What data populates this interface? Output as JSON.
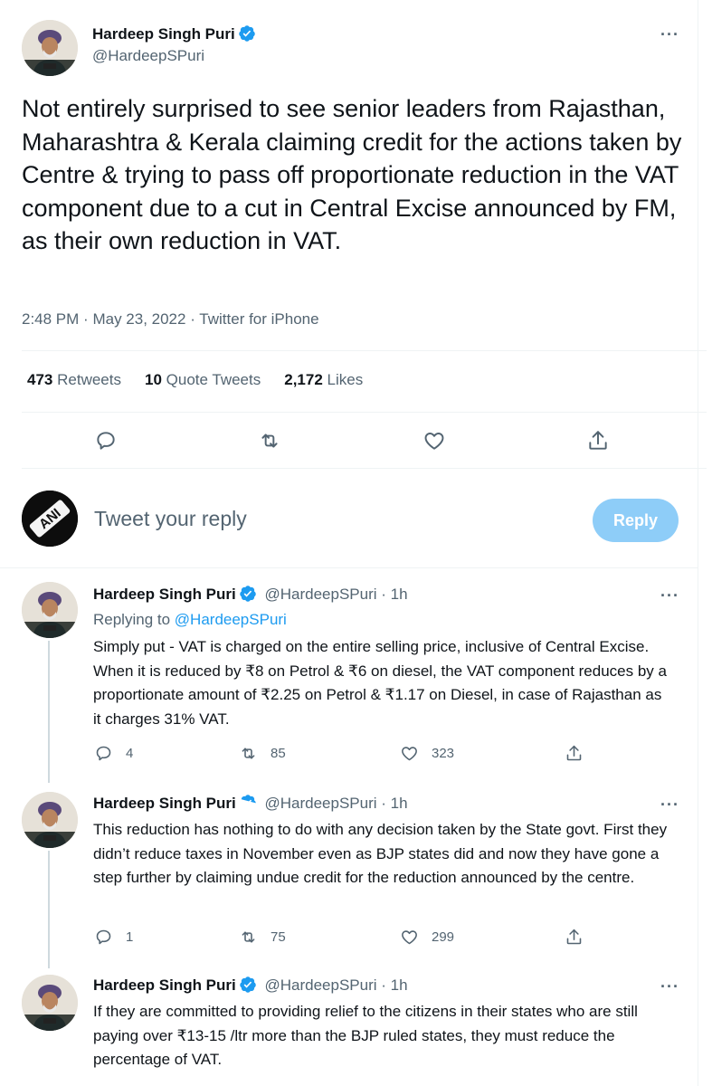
{
  "main_tweet": {
    "author_name": "Hardeep Singh Puri",
    "author_handle": "@HardeepSPuri",
    "text": "Not entirely surprised to see senior leaders from Rajasthan, Maharashtra & Kerala claiming credit for the actions taken by Centre & trying to pass off proportionate reduction in the VAT component due to a cut in Central Excise announced by FM, as their own reduction in VAT.",
    "time": "2:48 PM",
    "date": "May 23, 2022",
    "source": "Twitter for iPhone",
    "retweets": "473",
    "retweets_label": "Retweets",
    "quote_tweets": "10",
    "quote_tweets_label": "Quote Tweets",
    "likes": "2,172",
    "likes_label": "Likes"
  },
  "composer": {
    "placeholder": "Tweet your reply",
    "button_label": "Reply",
    "avatar_text": "ANI"
  },
  "replies": [
    {
      "author_name": "Hardeep Singh Puri",
      "author_handle": "@HardeepSPuri",
      "age": "1h",
      "replying_to_label": "Replying to",
      "replying_to_handle": "@HardeepSPuri",
      "text": "Simply put - VAT is charged on the entire selling price, inclusive of Central Excise. When it is reduced by ₹8 on Petrol & ₹6 on diesel, the VAT component reduces by a proportionate amount of ₹2.25 on Petrol & ₹1.17 on Diesel, in case of Rajasthan as it charges 31% VAT.",
      "replies": "4",
      "retweets": "85",
      "likes": "323"
    },
    {
      "author_name": "Hardeep Singh Puri",
      "author_handle": "@HardeepSPuri",
      "age": "1h",
      "text": "This reduction has nothing to do with any decision taken by the State govt. First they didn’t reduce taxes in November even as BJP states did and now they have gone a step further by claiming undue credit for the reduction announced by the centre.",
      "replies": "1",
      "retweets": "75",
      "likes": "299"
    },
    {
      "author_name": "Hardeep Singh Puri",
      "author_handle": "@HardeepSPuri",
      "age": "1h",
      "text": "If they are committed to providing relief to the citizens in their states who are still paying over ₹13-15 /ltr more than the BJP ruled states, they must reduce the percentage of VAT."
    }
  ],
  "colors": {
    "accent": "#1d9bf0",
    "muted": "#536471",
    "reply_button_disabled": "#8ecdf8"
  }
}
